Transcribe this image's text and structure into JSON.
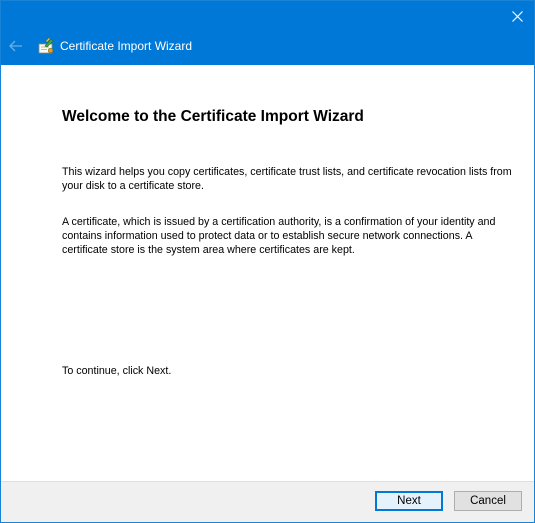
{
  "window": {
    "title": "Certificate Import Wizard"
  },
  "titlebar": {
    "back_icon": "back-arrow-icon",
    "app_icon": "certificate-icon",
    "close_icon": "close-icon"
  },
  "content": {
    "heading": "Welcome to the Certificate Import Wizard",
    "paragraph1": "This wizard helps you copy certificates, certificate trust lists, and certificate revocation lists from your disk to a certificate store.",
    "paragraph2": "A certificate, which is issued by a certification authority, is a confirmation of your identity and contains information used to protect data or to establish secure network connections. A certificate store is the system area where certificates are kept.",
    "paragraph3": "To continue, click Next."
  },
  "footer": {
    "next_label": "Next",
    "cancel_label": "Cancel"
  },
  "colors": {
    "titlebar": "#0078d7",
    "footer": "#f0f0f0",
    "default_button_border": "#0078d7"
  }
}
